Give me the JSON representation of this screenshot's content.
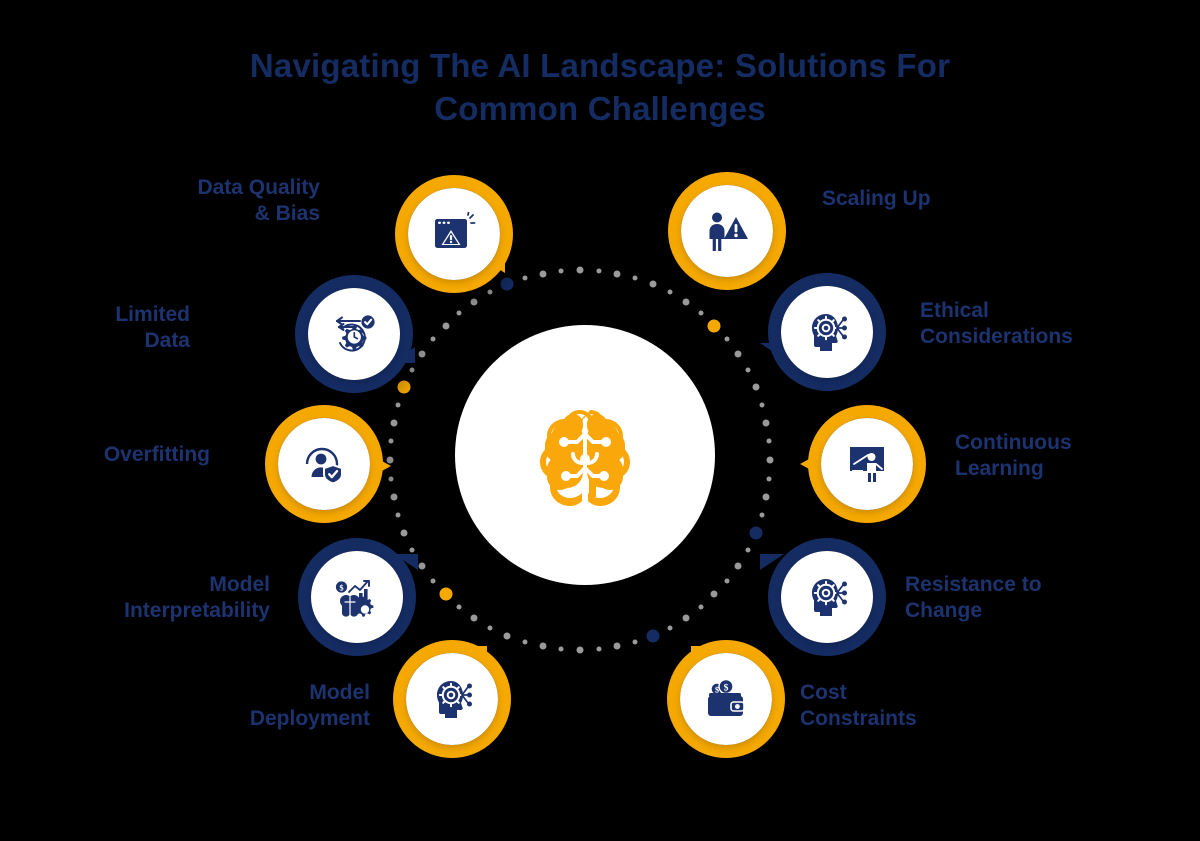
{
  "title": "Navigating The AI Landscape: Solutions For Common Challenges",
  "colors": {
    "navy": "#152c63",
    "label_navy": "#1d3370",
    "orange": "#f5a800",
    "white": "#ffffff",
    "background": "#000000",
    "dot_gray": "#9a9a9a"
  },
  "center": {
    "icon": "ai-brain-icon",
    "icon_color": "#f5a800"
  },
  "nodes": [
    {
      "id": "data-quality-bias",
      "label": "Data Quality\n& Bias",
      "icon": "browser-warning-icon",
      "ring": "orange",
      "side": "left"
    },
    {
      "id": "limited-data",
      "label": "Limited\nData",
      "icon": "clock-gear-check-icon",
      "ring": "navy",
      "side": "left"
    },
    {
      "id": "overfitting",
      "label": "Overfitting",
      "icon": "user-shield-check-icon",
      "ring": "orange",
      "side": "left"
    },
    {
      "id": "model-interpretability",
      "label": "Model\nInterpretability",
      "icon": "analytics-brain-gear-icon",
      "ring": "navy",
      "side": "left"
    },
    {
      "id": "model-deployment",
      "label": "Model\nDeployment",
      "icon": "head-gear-network-icon",
      "ring": "orange",
      "side": "left"
    },
    {
      "id": "scaling-up",
      "label": "Scaling Up",
      "icon": "person-warning-icon",
      "ring": "orange",
      "side": "right"
    },
    {
      "id": "ethical-considerations",
      "label": "Ethical\nConsiderations",
      "icon": "head-gear-network-icon",
      "ring": "navy",
      "side": "right"
    },
    {
      "id": "continuous-learning",
      "label": "Continuous\nLearning",
      "icon": "presentation-board-icon",
      "ring": "orange",
      "side": "right"
    },
    {
      "id": "resistance-to-change",
      "label": "Resistance to\nChange",
      "icon": "head-gear-network-icon",
      "ring": "navy",
      "side": "right"
    },
    {
      "id": "cost-constraints",
      "label": "Cost\nConstraints",
      "icon": "wallet-money-icon",
      "ring": "orange",
      "side": "right"
    }
  ]
}
